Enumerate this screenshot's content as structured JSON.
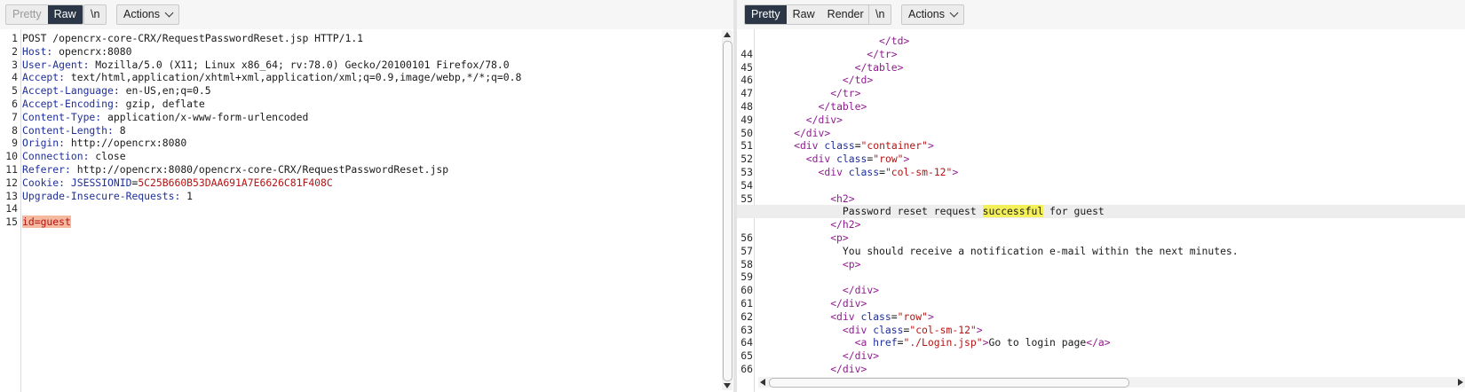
{
  "request": {
    "toolbar": {
      "pretty": "Pretty",
      "raw": "Raw",
      "newline": "\\n",
      "actions": "Actions"
    },
    "lines": [
      {
        "n": "1",
        "parts": [
          [
            "t",
            "POST /opencrx-core-CRX/RequestPasswordReset.jsp HTTP/1.1"
          ]
        ]
      },
      {
        "n": "2",
        "parts": [
          [
            "hk",
            "Host:"
          ],
          [
            "hv",
            " opencrx:8080"
          ]
        ]
      },
      {
        "n": "3",
        "parts": [
          [
            "hk",
            "User-Agent:"
          ],
          [
            "hv",
            " Mozilla/5.0 (X11; Linux x86_64; rv:78.0) Gecko/20100101 Firefox/78.0"
          ]
        ]
      },
      {
        "n": "4",
        "parts": [
          [
            "hk",
            "Accept:"
          ],
          [
            "hv",
            " text/html,application/xhtml+xml,application/xml;q=0.9,image/webp,*/*;q=0.8"
          ]
        ]
      },
      {
        "n": "5",
        "parts": [
          [
            "hk",
            "Accept-Language:"
          ],
          [
            "hv",
            " en-US,en;q=0.5"
          ]
        ]
      },
      {
        "n": "6",
        "parts": [
          [
            "hk",
            "Accept-Encoding:"
          ],
          [
            "hv",
            " gzip, deflate"
          ]
        ]
      },
      {
        "n": "7",
        "parts": [
          [
            "hk",
            "Content-Type:"
          ],
          [
            "hv",
            " application/x-www-form-urlencoded"
          ]
        ]
      },
      {
        "n": "8",
        "parts": [
          [
            "hk",
            "Content-Length:"
          ],
          [
            "hv",
            " 8"
          ]
        ]
      },
      {
        "n": "9",
        "parts": [
          [
            "hk",
            "Origin:"
          ],
          [
            "hv",
            " http://opencrx:8080"
          ]
        ]
      },
      {
        "n": "10",
        "parts": [
          [
            "hk",
            "Connection:"
          ],
          [
            "hv",
            " close"
          ]
        ]
      },
      {
        "n": "11",
        "parts": [
          [
            "hk",
            "Referer:"
          ],
          [
            "hv",
            " http://opencrx:8080/opencrx-core-CRX/RequestPasswordReset.jsp"
          ]
        ]
      },
      {
        "n": "12",
        "parts": [
          [
            "hk",
            "Cookie:"
          ],
          [
            "hv",
            " "
          ],
          [
            "ck",
            "JSESSIONID"
          ],
          [
            "hv",
            "="
          ],
          [
            "cv",
            "5C25B660B53DAA691A7E6626C81F408C"
          ]
        ]
      },
      {
        "n": "13",
        "parts": [
          [
            "hk",
            "Upgrade-Insecure-Requests:"
          ],
          [
            "hv",
            " 1"
          ]
        ]
      },
      {
        "n": "14",
        "parts": []
      },
      {
        "n": "15",
        "parts": [
          [
            "bk",
            "id"
          ],
          [
            "bp",
            "=guest"
          ]
        ]
      }
    ]
  },
  "response": {
    "toolbar": {
      "pretty": "Pretty",
      "raw": "Raw",
      "render": "Render",
      "newline": "\\n",
      "actions": "Actions"
    },
    "lines": [
      {
        "n": "",
        "indent": 10,
        "parts": [
          [
            "tg",
            "</td>"
          ]
        ]
      },
      {
        "n": "44",
        "indent": 9,
        "parts": [
          [
            "tg",
            "</tr>"
          ]
        ]
      },
      {
        "n": "45",
        "indent": 8,
        "parts": [
          [
            "tg",
            "</table>"
          ]
        ]
      },
      {
        "n": "46",
        "indent": 7,
        "parts": [
          [
            "tg",
            "</td>"
          ]
        ]
      },
      {
        "n": "47",
        "indent": 6,
        "parts": [
          [
            "tg",
            "</tr>"
          ]
        ]
      },
      {
        "n": "48",
        "indent": 5,
        "parts": [
          [
            "tg",
            "</table>"
          ]
        ]
      },
      {
        "n": "49",
        "indent": 4,
        "parts": [
          [
            "tg",
            "</div>"
          ]
        ]
      },
      {
        "n": "50",
        "indent": 3,
        "parts": [
          [
            "tg",
            "</div>"
          ]
        ]
      },
      {
        "n": "51",
        "indent": 3,
        "parts": [
          [
            "tg",
            "<div "
          ],
          [
            "at",
            "class"
          ],
          [
            "t",
            "="
          ],
          [
            "av",
            "\"container\""
          ],
          [
            "tg",
            ">"
          ]
        ]
      },
      {
        "n": "52",
        "indent": 4,
        "parts": [
          [
            "tg",
            "<div "
          ],
          [
            "at",
            "class"
          ],
          [
            "t",
            "="
          ],
          [
            "av",
            "\"row\""
          ],
          [
            "tg",
            ">"
          ]
        ]
      },
      {
        "n": "53",
        "indent": 5,
        "parts": [
          [
            "tg",
            "<div "
          ],
          [
            "at",
            "class"
          ],
          [
            "t",
            "="
          ],
          [
            "av",
            "\"col-sm-12\""
          ],
          [
            "tg",
            ">"
          ]
        ]
      },
      {
        "n": "54",
        "indent": 0,
        "parts": []
      },
      {
        "n": "55",
        "indent": 6,
        "parts": [
          [
            "tg",
            "<h2>"
          ]
        ]
      },
      {
        "n": "",
        "indent": 7,
        "hl": true,
        "parts": [
          [
            "t",
            "Password reset request "
          ],
          [
            "hw",
            "successful"
          ],
          [
            "t",
            " for guest"
          ]
        ]
      },
      {
        "n": "",
        "indent": 6,
        "parts": [
          [
            "tg",
            "</h2>"
          ]
        ]
      },
      {
        "n": "56",
        "indent": 6,
        "parts": [
          [
            "tg",
            "<p>"
          ]
        ]
      },
      {
        "n": "57",
        "indent": 7,
        "parts": [
          [
            "t",
            "You should receive a notification e-mail within the next minutes."
          ]
        ]
      },
      {
        "n": "58",
        "indent": 7,
        "parts": [
          [
            "tg",
            "<p>"
          ]
        ]
      },
      {
        "n": "59",
        "indent": 0,
        "parts": []
      },
      {
        "n": "60",
        "indent": 7,
        "parts": [
          [
            "tg",
            "</div>"
          ]
        ]
      },
      {
        "n": "61",
        "indent": 6,
        "parts": [
          [
            "tg",
            "</div>"
          ]
        ]
      },
      {
        "n": "62",
        "indent": 6,
        "parts": [
          [
            "tg",
            "<div "
          ],
          [
            "at",
            "class"
          ],
          [
            "t",
            "="
          ],
          [
            "av",
            "\"row\""
          ],
          [
            "tg",
            ">"
          ]
        ]
      },
      {
        "n": "63",
        "indent": 7,
        "parts": [
          [
            "tg",
            "<div "
          ],
          [
            "at",
            "class"
          ],
          [
            "t",
            "="
          ],
          [
            "av",
            "\"col-sm-12\""
          ],
          [
            "tg",
            ">"
          ]
        ]
      },
      {
        "n": "64",
        "indent": 8,
        "parts": [
          [
            "tg",
            "<a "
          ],
          [
            "at",
            "href"
          ],
          [
            "t",
            "="
          ],
          [
            "av",
            "\"./Login.jsp\""
          ],
          [
            "tg",
            ">"
          ],
          [
            "t",
            "Go to login page"
          ],
          [
            "tg",
            "</a>"
          ]
        ]
      },
      {
        "n": "65",
        "indent": 7,
        "parts": [
          [
            "tg",
            "</div>"
          ]
        ]
      },
      {
        "n": "66",
        "indent": 6,
        "parts": [
          [
            "tg",
            "</div>"
          ]
        ]
      }
    ]
  }
}
